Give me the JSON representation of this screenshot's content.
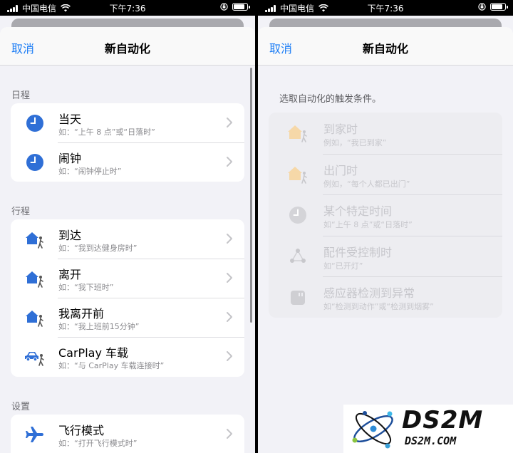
{
  "status_bar": {
    "carrier": "中国电信",
    "time": "下午7:36"
  },
  "left": {
    "nav": {
      "cancel": "取消",
      "title": "新自动化"
    },
    "sections": [
      {
        "header": "日程",
        "items": [
          {
            "icon": "clock-icon",
            "title": "当天",
            "subtitle": "如：“上午 8 点”或“日落时”"
          },
          {
            "icon": "clock-icon",
            "title": "闹钟",
            "subtitle": "如：“闹钟停止时”"
          }
        ]
      },
      {
        "header": "行程",
        "items": [
          {
            "icon": "house-person-icon",
            "title": "到达",
            "subtitle": "如：“我到达健身房时”"
          },
          {
            "icon": "house-person-icon",
            "title": "离开",
            "subtitle": "如：“我下班时”"
          },
          {
            "icon": "house-person-icon",
            "title": "我离开前",
            "subtitle": "如：“我上班前15分钟”"
          },
          {
            "icon": "car-person-icon",
            "title": "CarPlay 车载",
            "subtitle": "如：“与 CarPlay 车载连接时”"
          }
        ]
      },
      {
        "header": "设置",
        "items": [
          {
            "icon": "airplane-icon",
            "title": "飞行模式",
            "subtitle": "如：“打开飞行模式时”"
          }
        ]
      }
    ]
  },
  "right": {
    "nav": {
      "cancel": "取消",
      "title": "新自动化"
    },
    "prompt": "选取自动化的触发条件。",
    "items": [
      {
        "icon": "house-person-icon",
        "title": "到家时",
        "subtitle": "例如，“我已到家”"
      },
      {
        "icon": "house-person-icon",
        "title": "出门时",
        "subtitle": "例如，“每个人都已出门”"
      },
      {
        "icon": "clock-icon",
        "title": "某个特定时间",
        "subtitle": "如“上午 8 点”或“日落时”"
      },
      {
        "icon": "accessory-icon",
        "title": "配件受控制时",
        "subtitle": "如“已开灯”"
      },
      {
        "icon": "sensor-icon",
        "title": "感应器检测到异常",
        "subtitle": "如“检测到动作”或“检测到烟雾”"
      }
    ]
  },
  "watermark": {
    "brand": "DS2M",
    "domain": "DS2M.COM"
  },
  "colors": {
    "accent": "#1a7cf5",
    "icon_blue": "#2f6fd6",
    "disabled_text": "#c7c7cc",
    "house_disabled": "#f6d8a8"
  }
}
